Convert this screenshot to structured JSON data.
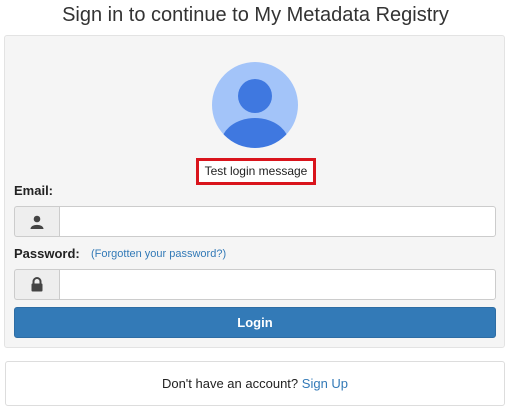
{
  "page": {
    "heading": "Sign in to continue to My Metadata Registry"
  },
  "login": {
    "message": "Test login message",
    "email_label": "Email:",
    "email_value": "",
    "password_label": "Password:",
    "forgot_link": "(Forgotten your password?)",
    "password_value": "",
    "login_button": "Login",
    "icons": {
      "avatar": "user-avatar-icon",
      "email": "user-icon",
      "password": "lock-icon"
    }
  },
  "signup": {
    "prompt": "Don't have an account?",
    "link": "Sign Up"
  },
  "colors": {
    "primary": "#337ab7",
    "message_border": "#d9141c",
    "avatar_bg": "#a3c4f9",
    "avatar_figure": "#3f78e0"
  }
}
